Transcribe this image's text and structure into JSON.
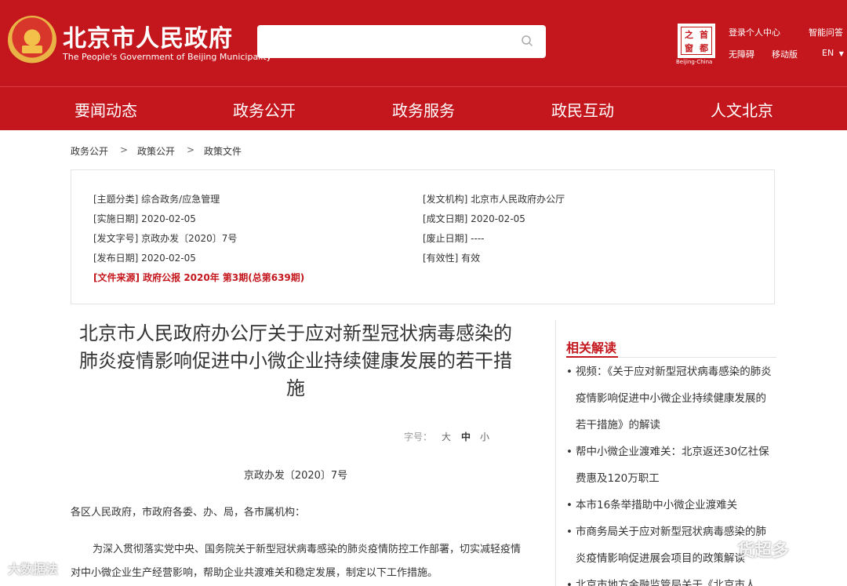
{
  "header": {
    "title": "北京市人民政府",
    "subtitle": "The People's Government of Beijing Municipality",
    "search_placeholder": "",
    "brand_chars": [
      "之",
      "首",
      "窗",
      "都"
    ],
    "brand_caption": "Beijing-China",
    "links": {
      "login": "登录个人中心",
      "assistant": "智能问答",
      "accessible": "无障碍",
      "mobile": "移动版",
      "lang": "EN"
    }
  },
  "nav": {
    "items": [
      "要闻动态",
      "政务公开",
      "政务服务",
      "政民互动",
      "人文北京"
    ]
  },
  "breadcrumb": {
    "items": [
      "政务公开",
      "政策公开",
      "政策文件"
    ],
    "sep": ">"
  },
  "info": {
    "topic": "[主题分类] 综合政务/应急管理",
    "agency": "[发文机构] 北京市人民政府办公厅",
    "effective_date": "[实施日期] 2020-02-05",
    "written_date": "[成文日期] 2020-02-05",
    "doc_number": "[发文字号] 京政办发〔2020〕7号",
    "repeal_date": "[废止日期] ----",
    "publish_date": "[发布日期] 2020-02-05",
    "validity": "[有效性] 有效",
    "source": "[文件来源] 政府公报 2020年 第3期(总第639期)"
  },
  "article": {
    "title": "北京市人民政府办公厅关于应对新型冠状病毒感染的肺炎疫情影响促进中小微企业持续健康发展的若干措施",
    "font_size_label": "字号：",
    "font_sizes": [
      "大",
      "中",
      "小"
    ],
    "doc_no": "京政办发〔2020〕7号",
    "addressee": "各区人民政府，市政府各委、办、局，各市属机构：",
    "paragraph": "为深入贯彻落实党中央、国务院关于新型冠状病毒感染的肺炎疫情防控工作部署，切实减轻疫情对中小微企业生产经营影响，帮助企业共渡难关和稳定发展，制定以下工作措施。"
  },
  "related": {
    "heading": "相关解读",
    "items": [
      "视频：《关于应对新型冠状病毒感染的肺炎疫情影响促进中小微企业持续健康发展的若干措施》的解读",
      "帮中小微企业渡难关：北京返还30亿社保费惠及120万职工",
      "本市16条举措助中小微企业渡难关",
      "市商务局关于应对新型冠状病毒感染的肺炎疫情影响促进展会项目的政策解读",
      "北京市地方金融监管局关于《北京市人"
    ]
  },
  "watermarks": {
    "left": "大数据法",
    "right": "货超多"
  },
  "colors": {
    "brand_red": "#c4171d"
  }
}
